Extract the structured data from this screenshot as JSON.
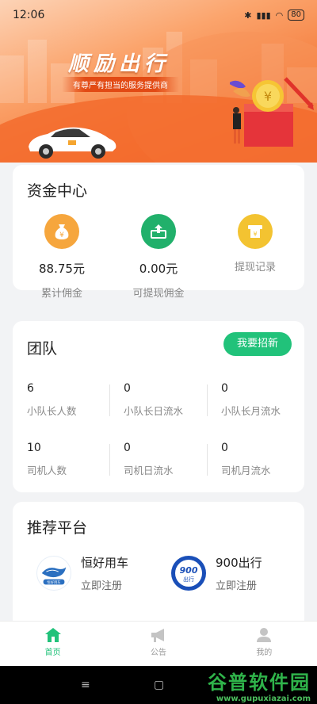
{
  "status_bar": {
    "time": "12:06",
    "battery": "80"
  },
  "banner": {
    "title": "顺励出行",
    "subtitle": "有尊严有担当的服务提供商"
  },
  "fund_center": {
    "title": "资金中心",
    "items": [
      {
        "value": "88.75元",
        "label": "累计佣金",
        "icon": "money-bag-icon",
        "color": "#f6a63d"
      },
      {
        "value": "0.00元",
        "label": "可提现佣金",
        "icon": "withdraw-icon",
        "color": "#21b06b"
      },
      {
        "value": "",
        "label": "提现记录",
        "icon": "record-icon",
        "color": "#f3c331"
      }
    ]
  },
  "team": {
    "title": "团队",
    "recruit_label": "我要招新",
    "stats": [
      {
        "value": "6",
        "label": "小队长人数"
      },
      {
        "value": "0",
        "label": "小队长日流水"
      },
      {
        "value": "0",
        "label": "小队长月流水"
      },
      {
        "value": "10",
        "label": "司机人数"
      },
      {
        "value": "0",
        "label": "司机日流水"
      },
      {
        "value": "0",
        "label": "司机月流水"
      }
    ]
  },
  "recommended": {
    "title": "推荐平台",
    "platforms": [
      {
        "name": "恒好用车",
        "action": "立即注册",
        "logo_text": "恒好用车"
      },
      {
        "name": "900出行",
        "action": "立即注册",
        "logo_text": "900",
        "logo_sub": "出行"
      }
    ]
  },
  "bottom_nav": [
    {
      "label": "首页",
      "icon": "home-icon",
      "active": true
    },
    {
      "label": "公告",
      "icon": "megaphone-icon",
      "active": false
    },
    {
      "label": "我的",
      "icon": "user-icon",
      "active": false
    }
  ],
  "watermark": {
    "main": "谷普软件园",
    "url": "www.gupuxiazai.com"
  },
  "colors": {
    "accent": "#21c27a",
    "banner": "#f47a3a"
  }
}
